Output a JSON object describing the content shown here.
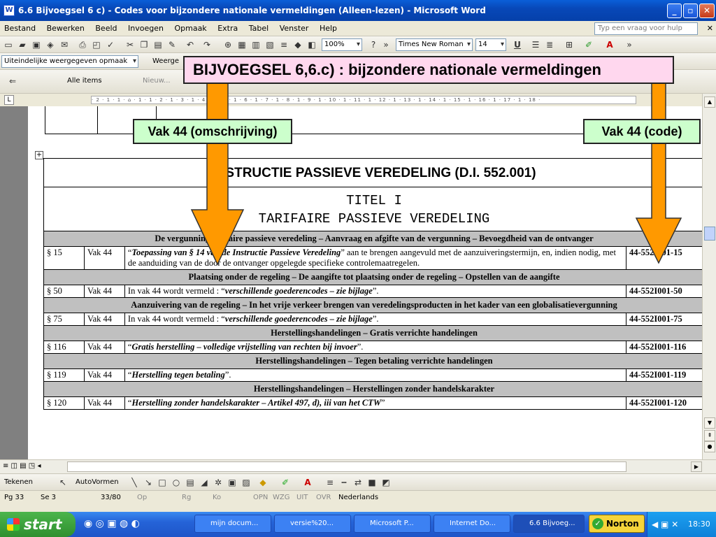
{
  "window": {
    "title": "6.6 Bijvoegsel 6 c) - Codes voor bijzondere nationale vermeldingen (Alleen-lezen) - Microsoft Word",
    "app_icon": "word-icon"
  },
  "menu": [
    "Bestand",
    "Bewerken",
    "Beeld",
    "Invoegen",
    "Opmaak",
    "Extra",
    "Tabel",
    "Venster",
    "Help"
  ],
  "help_placeholder": "Typ een vraag voor hulp",
  "toolbar": {
    "zoom": "100%",
    "font": "Times New Roman",
    "size": "14"
  },
  "reading": {
    "view": "Uiteindelijke weergegeven opmaak",
    "show": "Weerge",
    "items": "Alle items",
    "new": "Nieuw..."
  },
  "ruler_text": "· 2 · 1 · 1 · ⌂ · 1 · 1 · 2 · 1 · 3 · 1 · 4 · 1 · 5 · 1 · 6 · 1 · 7 · 1 · 8 · 1 · 9 · 1 · 10 · 1 · 11 · 1 · 12 · 1 · 13 · 1 · 14 · 1 · 15 · 1 · 16 · 1 · 17 · 1 · 18 ·",
  "callouts": {
    "main": "BIJVOEGSEL 6,6.c) : bijzondere nationale vermeldingen",
    "left": "Vak 44 (omschrijving)",
    "right": "Vak 44 (code)"
  },
  "doc": {
    "heading": "INSTRUCTIE PASSIEVE VEREDELING (D.I. 552.001)",
    "title1": "TITEL I",
    "title2": "TARIFAIRE PASSIEVE VEREDELING",
    "rows": [
      {
        "type": "hdr",
        "text": "De vergunning tarifaire passieve veredeling – Aanvraag en afgifte van de vergunning – Bevoegdheid van de ontvanger"
      },
      {
        "type": "row",
        "par": "§ 15",
        "vak": "Vak 44",
        "lead": "“",
        "em": "Toepassing van § 14 van de Instructie Passieve Veredeling",
        "tail": "” aan te brengen aangevuld met de aanzuiveringstermijn, en, indien nodig, met de aanduiding van de door de ontvanger opgelegde specifieke controlemaatregelen.",
        "code": "44-552I001-15"
      },
      {
        "type": "hdr",
        "text": "Plaatsing onder de regeling – De aangifte tot plaatsing onder de regeling – Opstellen van de aangifte"
      },
      {
        "type": "row",
        "par": "§ 50",
        "vak": "Vak 44",
        "lead": "In vak 44 wordt vermeld : “",
        "em": "verschillende goederencodes – zie bijlage",
        "tail": "”.",
        "code": "44-552I001-50"
      },
      {
        "type": "hdr",
        "text": "Aanzuivering van de regeling – In het vrije verkeer brengen van veredelingsproducten in het kader van een globalisatievergunning"
      },
      {
        "type": "row",
        "par": "§ 75",
        "vak": "Vak 44",
        "lead": "In vak 44 wordt vermeld : “",
        "em": "verschillende goederencodes – zie bijlage",
        "tail": "”.",
        "code": "44-552I001-75"
      },
      {
        "type": "hdr",
        "text": "Herstellingshandelingen – Gratis verrichte handelingen"
      },
      {
        "type": "row",
        "par": "§ 116",
        "vak": "Vak 44",
        "lead": "“",
        "em": "Gratis herstelling – volledige vrijstelling van rechten bij invoer",
        "tail": "”.",
        "code": "44-552I001-116"
      },
      {
        "type": "hdr",
        "text": "Herstellingshandelingen – Tegen betaling verrichte handelingen"
      },
      {
        "type": "row",
        "par": "§ 119",
        "vak": "Vak 44",
        "lead": "“",
        "em": "Herstelling tegen betaling",
        "tail": "”.",
        "code": "44-552I001-119"
      },
      {
        "type": "hdr",
        "text": "Herstellingshandelingen – Herstellingen zonder handelskarakter"
      },
      {
        "type": "row",
        "par": "§ 120",
        "vak": "Vak 44",
        "lead": "“",
        "em": "Herstelling zonder handelskarakter – Artikel 497, d), iii van het CTW",
        "tail": "”",
        "code": "44-552I001-120"
      }
    ]
  },
  "drawing": {
    "draw": "Tekenen",
    "autoshapes": "AutoVormen"
  },
  "status": {
    "pg": "Pg 33",
    "se": "Se 3",
    "pages": "33/80",
    "op": "Op",
    "rg": "Rg",
    "ko": "Ko",
    "opn": "OPN",
    "wzg": "WZG",
    "uit": "UIT",
    "ovr": "OVR",
    "lang": "Nederlands"
  },
  "taskbar": {
    "start": "start",
    "buttons": [
      "mijn docum...",
      "versie%20...",
      "Microsoft P...",
      "Internet Do...",
      "6.6 Bijvoeg..."
    ],
    "norton": "Norton",
    "clock": "18:30"
  }
}
